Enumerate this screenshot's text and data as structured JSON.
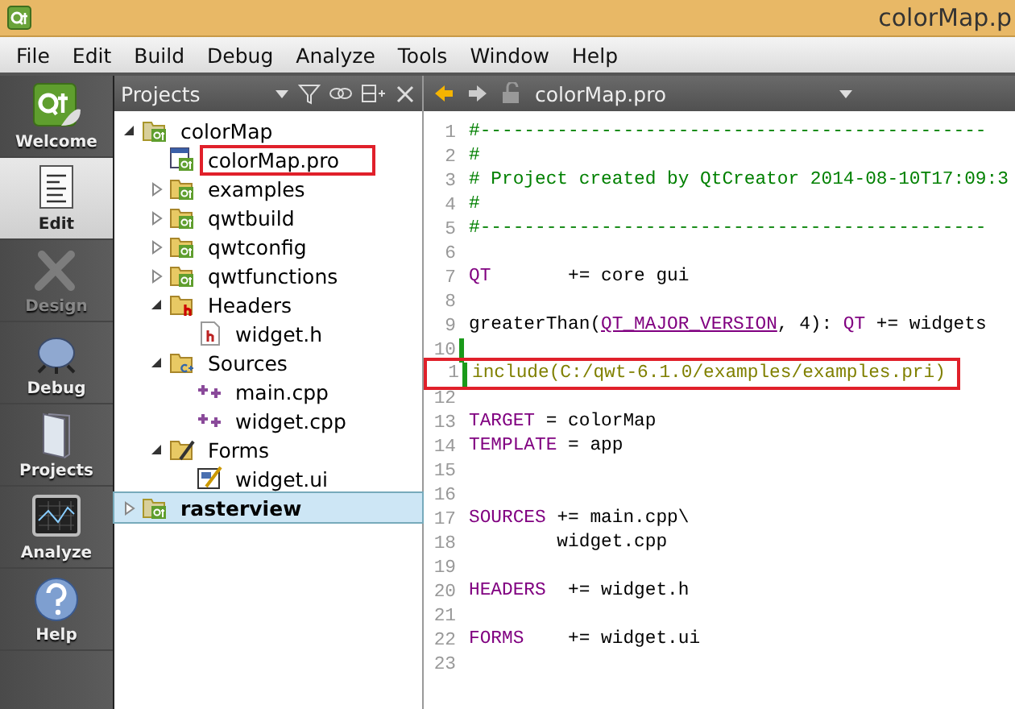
{
  "window": {
    "title": "colorMap.p"
  },
  "menu": [
    "File",
    "Edit",
    "Build",
    "Debug",
    "Analyze",
    "Tools",
    "Window",
    "Help"
  ],
  "modes": [
    {
      "label": "Welcome",
      "kind": "welcome",
      "selected": false,
      "disabled": false
    },
    {
      "label": "Edit",
      "kind": "edit",
      "selected": true,
      "disabled": false
    },
    {
      "label": "Design",
      "kind": "design",
      "selected": false,
      "disabled": true
    },
    {
      "label": "Debug",
      "kind": "debug",
      "selected": false,
      "disabled": false
    },
    {
      "label": "Projects",
      "kind": "projects",
      "selected": false,
      "disabled": false
    },
    {
      "label": "Analyze",
      "kind": "analyze",
      "selected": false,
      "disabled": false
    },
    {
      "label": "Help",
      "kind": "help",
      "selected": false,
      "disabled": false
    }
  ],
  "projects_panel": {
    "title": "Projects",
    "tree": [
      {
        "label": "colorMap",
        "kind": "project",
        "expanded": true,
        "selected": false,
        "highlighted": false,
        "children": [
          {
            "label": "colorMap.pro",
            "kind": "pro-file",
            "selected": false,
            "highlighted": true
          },
          {
            "label": "examples",
            "kind": "subproject",
            "expanded": false,
            "selected": false,
            "highlighted": false
          },
          {
            "label": "qwtbuild",
            "kind": "subproject",
            "expanded": false,
            "selected": false,
            "highlighted": false
          },
          {
            "label": "qwtconfig",
            "kind": "subproject",
            "expanded": false,
            "selected": false,
            "highlighted": false
          },
          {
            "label": "qwtfunctions",
            "kind": "subproject",
            "expanded": false,
            "selected": false,
            "highlighted": false
          },
          {
            "label": "Headers",
            "kind": "header-folder",
            "expanded": true,
            "selected": false,
            "highlighted": false,
            "children": [
              {
                "label": "widget.h",
                "kind": "header",
                "selected": false,
                "highlighted": false
              }
            ]
          },
          {
            "label": "Sources",
            "kind": "source-folder",
            "expanded": true,
            "selected": false,
            "highlighted": false,
            "children": [
              {
                "label": "main.cpp",
                "kind": "source",
                "selected": false,
                "highlighted": false
              },
              {
                "label": "widget.cpp",
                "kind": "source",
                "selected": false,
                "highlighted": false
              }
            ]
          },
          {
            "label": "Forms",
            "kind": "form-folder",
            "expanded": true,
            "selected": false,
            "highlighted": false,
            "children": [
              {
                "label": "widget.ui",
                "kind": "form",
                "selected": false,
                "highlighted": false
              }
            ]
          }
        ]
      },
      {
        "label": "rasterview",
        "kind": "project",
        "expanded": false,
        "selected": true,
        "highlighted": false
      }
    ]
  },
  "editor": {
    "file": "colorMap.pro",
    "lines": [
      {
        "number": "1",
        "changed": false,
        "highlighted": false,
        "tokens": [
          {
            "text": "#----------------------------------------------",
            "kind": "comment"
          }
        ]
      },
      {
        "number": "2",
        "changed": false,
        "highlighted": false,
        "tokens": [
          {
            "text": "#",
            "kind": "comment"
          }
        ]
      },
      {
        "number": "3",
        "changed": false,
        "highlighted": false,
        "tokens": [
          {
            "text": "# Project created by QtCreator 2014-08-10T17:09:3",
            "kind": "comment"
          }
        ]
      },
      {
        "number": "4",
        "changed": false,
        "highlighted": false,
        "tokens": [
          {
            "text": "#",
            "kind": "comment"
          }
        ]
      },
      {
        "number": "5",
        "changed": false,
        "highlighted": false,
        "tokens": [
          {
            "text": "#----------------------------------------------",
            "kind": "comment"
          }
        ]
      },
      {
        "number": "6",
        "changed": false,
        "highlighted": false
      },
      {
        "number": "7",
        "changed": false,
        "highlighted": false,
        "tokens": [
          {
            "text": "QT",
            "kind": "keyword"
          },
          {
            "text": "       += core gui",
            "kind": "plain"
          }
        ]
      },
      {
        "number": "8",
        "changed": false,
        "highlighted": false
      },
      {
        "number": "9",
        "changed": false,
        "highlighted": false,
        "tokens": [
          {
            "text": "greaterThan(",
            "kind": "plain"
          },
          {
            "text": "QT_MAJOR_VERSION",
            "kind": "macro"
          },
          {
            "text": ", 4): ",
            "kind": "plain"
          },
          {
            "text": "QT",
            "kind": "keyword"
          },
          {
            "text": " += widgets",
            "kind": "plain"
          }
        ]
      },
      {
        "number": "10",
        "changed": true,
        "highlighted": false
      },
      {
        "number": "1",
        "changed": true,
        "highlighted": true,
        "tokens": [
          {
            "text": "include(C:/qwt-6.1.0/examples/examples.pri)",
            "kind": "function"
          }
        ]
      },
      {
        "number": "12",
        "changed": false,
        "highlighted": false
      },
      {
        "number": "13",
        "changed": false,
        "highlighted": false,
        "tokens": [
          {
            "text": "TARGET",
            "kind": "keyword"
          },
          {
            "text": " = colorMap",
            "kind": "plain"
          }
        ]
      },
      {
        "number": "14",
        "changed": false,
        "highlighted": false,
        "tokens": [
          {
            "text": "TEMPLATE",
            "kind": "keyword"
          },
          {
            "text": " = app",
            "kind": "plain"
          }
        ]
      },
      {
        "number": "15",
        "changed": false,
        "highlighted": false
      },
      {
        "number": "16",
        "changed": false,
        "highlighted": false
      },
      {
        "number": "17",
        "changed": false,
        "highlighted": false,
        "tokens": [
          {
            "text": "SOURCES",
            "kind": "keyword"
          },
          {
            "text": " += main.cpp\\",
            "kind": "plain"
          }
        ]
      },
      {
        "number": "18",
        "changed": false,
        "highlighted": false,
        "tokens": [
          {
            "text": "        widget.cpp",
            "kind": "plain"
          }
        ]
      },
      {
        "number": "19",
        "changed": false,
        "highlighted": false
      },
      {
        "number": "20",
        "changed": false,
        "highlighted": false,
        "tokens": [
          {
            "text": "HEADERS",
            "kind": "keyword"
          },
          {
            "text": "  += widget.h",
            "kind": "plain"
          }
        ]
      },
      {
        "number": "21",
        "changed": false,
        "highlighted": false
      },
      {
        "number": "22",
        "changed": false,
        "highlighted": false,
        "tokens": [
          {
            "text": "FORMS",
            "kind": "keyword"
          },
          {
            "text": "    += widget.ui",
            "kind": "plain"
          }
        ]
      },
      {
        "number": "23",
        "changed": false,
        "highlighted": false
      }
    ]
  }
}
